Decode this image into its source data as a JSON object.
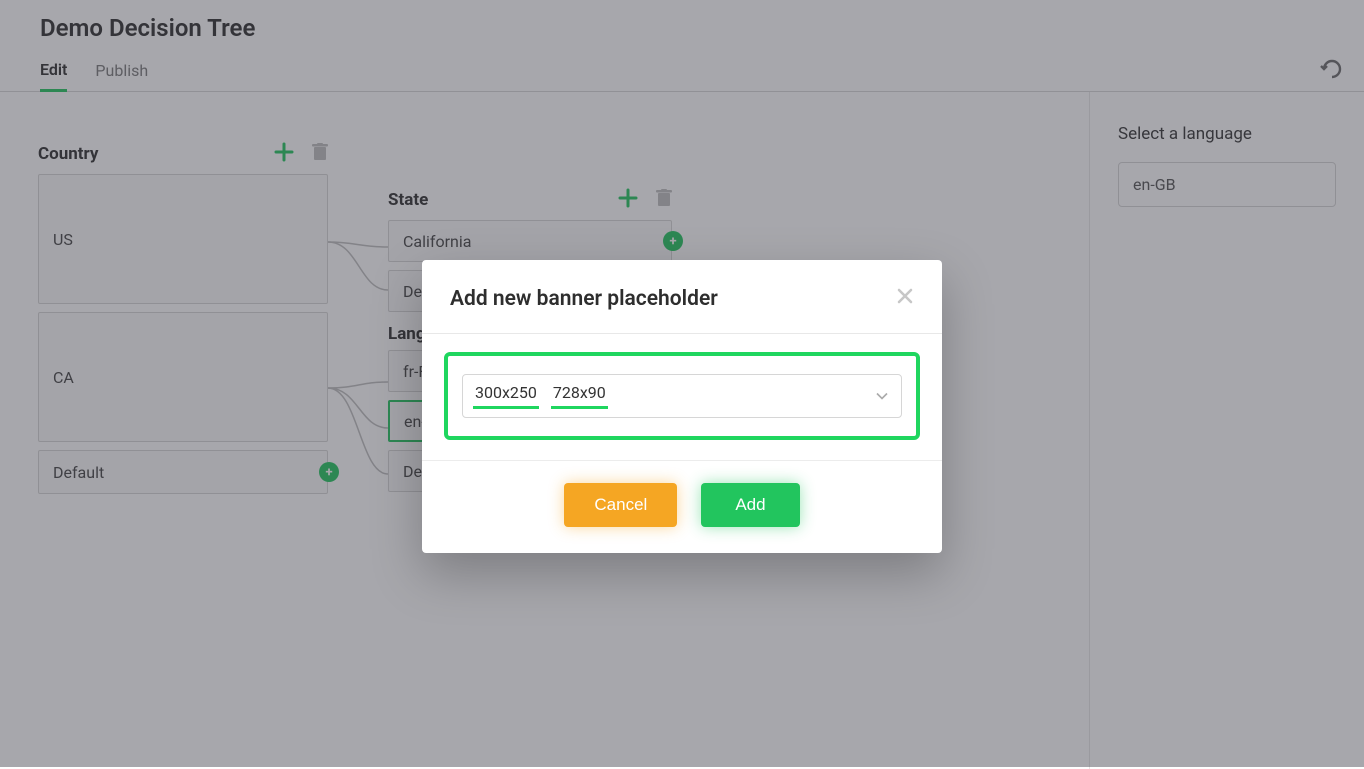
{
  "header": {
    "title": "Demo Decision Tree",
    "tabs": {
      "edit": "Edit",
      "publish": "Publish"
    }
  },
  "tree": {
    "country": {
      "title": "Country",
      "items": [
        "US",
        "CA",
        "Default"
      ]
    },
    "state": {
      "title": "State",
      "items": [
        "California",
        "Default"
      ]
    },
    "language": {
      "title": "Language",
      "items": [
        "fr-FR",
        "en-GB",
        "Default"
      ]
    }
  },
  "sidebar": {
    "label": "Select a language",
    "selected": "en-GB"
  },
  "modal": {
    "title": "Add new banner placeholder",
    "tags": [
      "300x250",
      "728x90"
    ],
    "buttons": {
      "cancel": "Cancel",
      "add": "Add"
    }
  }
}
